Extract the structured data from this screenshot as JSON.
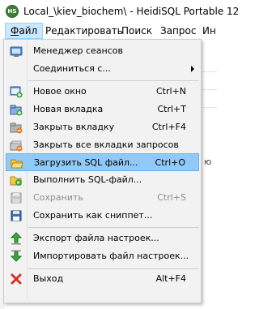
{
  "window": {
    "title": "Local_\\kiev_biochem\\ - HeidiSQL Portable 12",
    "icon": "heidisql-logo-icon",
    "icon_text": "HS"
  },
  "menubar": {
    "items": [
      {
        "label": "Файл",
        "active": true
      },
      {
        "label": "Редактировать"
      },
      {
        "label": "Поиск"
      },
      {
        "label": "Запрос"
      },
      {
        "label": "Ин"
      }
    ]
  },
  "background": {
    "side_text": "ю"
  },
  "file_menu": {
    "items": [
      {
        "label": "Менеджер сеансов",
        "shortcut": "",
        "icon": "session-manager-icon"
      },
      {
        "label": "Соединиться с...",
        "shortcut": "",
        "icon": "",
        "submenu": true
      },
      {
        "label": "Новое окно",
        "shortcut": "Ctrl+N",
        "icon": "new-window-icon"
      },
      {
        "label": "Новая вкладка",
        "shortcut": "Ctrl+T",
        "icon": "new-tab-icon"
      },
      {
        "label": "Закрыть вкладку",
        "shortcut": "Ctrl+F4",
        "icon": "close-tab-icon"
      },
      {
        "label": "Закрыть все вкладки запросов",
        "shortcut": "",
        "icon": "close-all-tabs-icon"
      },
      {
        "label": "Загрузить SQL файл...",
        "shortcut": "Ctrl+O",
        "icon": "open-folder-icon",
        "highlighted": true
      },
      {
        "label": "Выполнить SQL-файл...",
        "shortcut": "",
        "icon": "run-sql-file-icon"
      },
      {
        "label": "Сохранить",
        "shortcut": "Ctrl+S",
        "icon": "save-icon",
        "disabled": true
      },
      {
        "label": "Сохранить как сниппет...",
        "shortcut": "",
        "icon": "save-snippet-icon"
      },
      {
        "label": "Экспорт файла настроек...",
        "shortcut": "",
        "icon": "export-settings-icon"
      },
      {
        "label": "Импортировать файл настроек...",
        "shortcut": "",
        "icon": "import-settings-icon"
      },
      {
        "label": "Выход",
        "shortcut": "Alt+F4",
        "icon": "exit-icon"
      }
    ]
  },
  "colors": {
    "highlight": "#91c9f7",
    "menu_active": "#cce8ff",
    "disabled_text": "#8d8d8d"
  }
}
